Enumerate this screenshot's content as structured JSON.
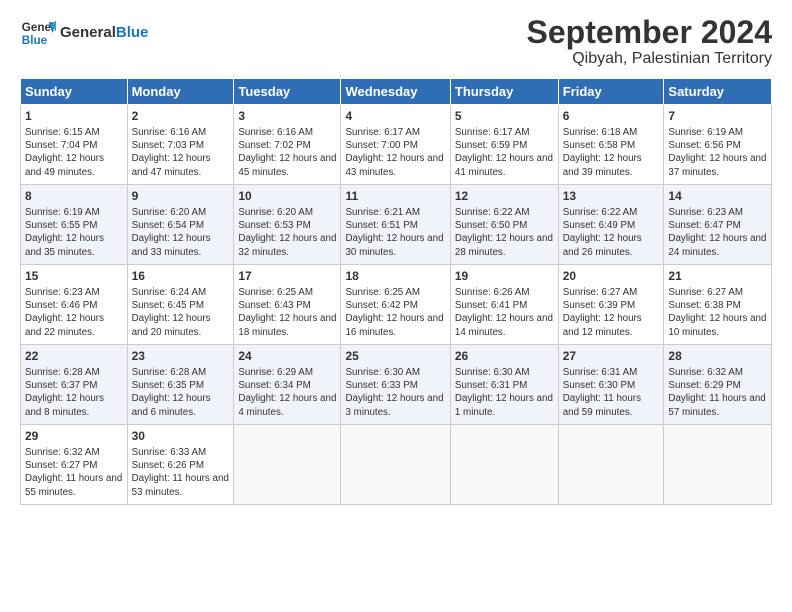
{
  "header": {
    "logo_general": "General",
    "logo_blue": "Blue",
    "main_title": "September 2024",
    "sub_title": "Qibyah, Palestinian Territory"
  },
  "weekdays": [
    "Sunday",
    "Monday",
    "Tuesday",
    "Wednesday",
    "Thursday",
    "Friday",
    "Saturday"
  ],
  "weeks": [
    [
      {
        "day": "1",
        "sunrise": "Sunrise: 6:15 AM",
        "sunset": "Sunset: 7:04 PM",
        "daylight": "Daylight: 12 hours and 49 minutes."
      },
      {
        "day": "2",
        "sunrise": "Sunrise: 6:16 AM",
        "sunset": "Sunset: 7:03 PM",
        "daylight": "Daylight: 12 hours and 47 minutes."
      },
      {
        "day": "3",
        "sunrise": "Sunrise: 6:16 AM",
        "sunset": "Sunset: 7:02 PM",
        "daylight": "Daylight: 12 hours and 45 minutes."
      },
      {
        "day": "4",
        "sunrise": "Sunrise: 6:17 AM",
        "sunset": "Sunset: 7:00 PM",
        "daylight": "Daylight: 12 hours and 43 minutes."
      },
      {
        "day": "5",
        "sunrise": "Sunrise: 6:17 AM",
        "sunset": "Sunset: 6:59 PM",
        "daylight": "Daylight: 12 hours and 41 minutes."
      },
      {
        "day": "6",
        "sunrise": "Sunrise: 6:18 AM",
        "sunset": "Sunset: 6:58 PM",
        "daylight": "Daylight: 12 hours and 39 minutes."
      },
      {
        "day": "7",
        "sunrise": "Sunrise: 6:19 AM",
        "sunset": "Sunset: 6:56 PM",
        "daylight": "Daylight: 12 hours and 37 minutes."
      }
    ],
    [
      {
        "day": "8",
        "sunrise": "Sunrise: 6:19 AM",
        "sunset": "Sunset: 6:55 PM",
        "daylight": "Daylight: 12 hours and 35 minutes."
      },
      {
        "day": "9",
        "sunrise": "Sunrise: 6:20 AM",
        "sunset": "Sunset: 6:54 PM",
        "daylight": "Daylight: 12 hours and 33 minutes."
      },
      {
        "day": "10",
        "sunrise": "Sunrise: 6:20 AM",
        "sunset": "Sunset: 6:53 PM",
        "daylight": "Daylight: 12 hours and 32 minutes."
      },
      {
        "day": "11",
        "sunrise": "Sunrise: 6:21 AM",
        "sunset": "Sunset: 6:51 PM",
        "daylight": "Daylight: 12 hours and 30 minutes."
      },
      {
        "day": "12",
        "sunrise": "Sunrise: 6:22 AM",
        "sunset": "Sunset: 6:50 PM",
        "daylight": "Daylight: 12 hours and 28 minutes."
      },
      {
        "day": "13",
        "sunrise": "Sunrise: 6:22 AM",
        "sunset": "Sunset: 6:49 PM",
        "daylight": "Daylight: 12 hours and 26 minutes."
      },
      {
        "day": "14",
        "sunrise": "Sunrise: 6:23 AM",
        "sunset": "Sunset: 6:47 PM",
        "daylight": "Daylight: 12 hours and 24 minutes."
      }
    ],
    [
      {
        "day": "15",
        "sunrise": "Sunrise: 6:23 AM",
        "sunset": "Sunset: 6:46 PM",
        "daylight": "Daylight: 12 hours and 22 minutes."
      },
      {
        "day": "16",
        "sunrise": "Sunrise: 6:24 AM",
        "sunset": "Sunset: 6:45 PM",
        "daylight": "Daylight: 12 hours and 20 minutes."
      },
      {
        "day": "17",
        "sunrise": "Sunrise: 6:25 AM",
        "sunset": "Sunset: 6:43 PM",
        "daylight": "Daylight: 12 hours and 18 minutes."
      },
      {
        "day": "18",
        "sunrise": "Sunrise: 6:25 AM",
        "sunset": "Sunset: 6:42 PM",
        "daylight": "Daylight: 12 hours and 16 minutes."
      },
      {
        "day": "19",
        "sunrise": "Sunrise: 6:26 AM",
        "sunset": "Sunset: 6:41 PM",
        "daylight": "Daylight: 12 hours and 14 minutes."
      },
      {
        "day": "20",
        "sunrise": "Sunrise: 6:27 AM",
        "sunset": "Sunset: 6:39 PM",
        "daylight": "Daylight: 12 hours and 12 minutes."
      },
      {
        "day": "21",
        "sunrise": "Sunrise: 6:27 AM",
        "sunset": "Sunset: 6:38 PM",
        "daylight": "Daylight: 12 hours and 10 minutes."
      }
    ],
    [
      {
        "day": "22",
        "sunrise": "Sunrise: 6:28 AM",
        "sunset": "Sunset: 6:37 PM",
        "daylight": "Daylight: 12 hours and 8 minutes."
      },
      {
        "day": "23",
        "sunrise": "Sunrise: 6:28 AM",
        "sunset": "Sunset: 6:35 PM",
        "daylight": "Daylight: 12 hours and 6 minutes."
      },
      {
        "day": "24",
        "sunrise": "Sunrise: 6:29 AM",
        "sunset": "Sunset: 6:34 PM",
        "daylight": "Daylight: 12 hours and 4 minutes."
      },
      {
        "day": "25",
        "sunrise": "Sunrise: 6:30 AM",
        "sunset": "Sunset: 6:33 PM",
        "daylight": "Daylight: 12 hours and 3 minutes."
      },
      {
        "day": "26",
        "sunrise": "Sunrise: 6:30 AM",
        "sunset": "Sunset: 6:31 PM",
        "daylight": "Daylight: 12 hours and 1 minute."
      },
      {
        "day": "27",
        "sunrise": "Sunrise: 6:31 AM",
        "sunset": "Sunset: 6:30 PM",
        "daylight": "Daylight: 11 hours and 59 minutes."
      },
      {
        "day": "28",
        "sunrise": "Sunrise: 6:32 AM",
        "sunset": "Sunset: 6:29 PM",
        "daylight": "Daylight: 11 hours and 57 minutes."
      }
    ],
    [
      {
        "day": "29",
        "sunrise": "Sunrise: 6:32 AM",
        "sunset": "Sunset: 6:27 PM",
        "daylight": "Daylight: 11 hours and 55 minutes."
      },
      {
        "day": "30",
        "sunrise": "Sunrise: 6:33 AM",
        "sunset": "Sunset: 6:26 PM",
        "daylight": "Daylight: 11 hours and 53 minutes."
      },
      {
        "day": "",
        "sunrise": "",
        "sunset": "",
        "daylight": ""
      },
      {
        "day": "",
        "sunrise": "",
        "sunset": "",
        "daylight": ""
      },
      {
        "day": "",
        "sunrise": "",
        "sunset": "",
        "daylight": ""
      },
      {
        "day": "",
        "sunrise": "",
        "sunset": "",
        "daylight": ""
      },
      {
        "day": "",
        "sunrise": "",
        "sunset": "",
        "daylight": ""
      }
    ]
  ]
}
